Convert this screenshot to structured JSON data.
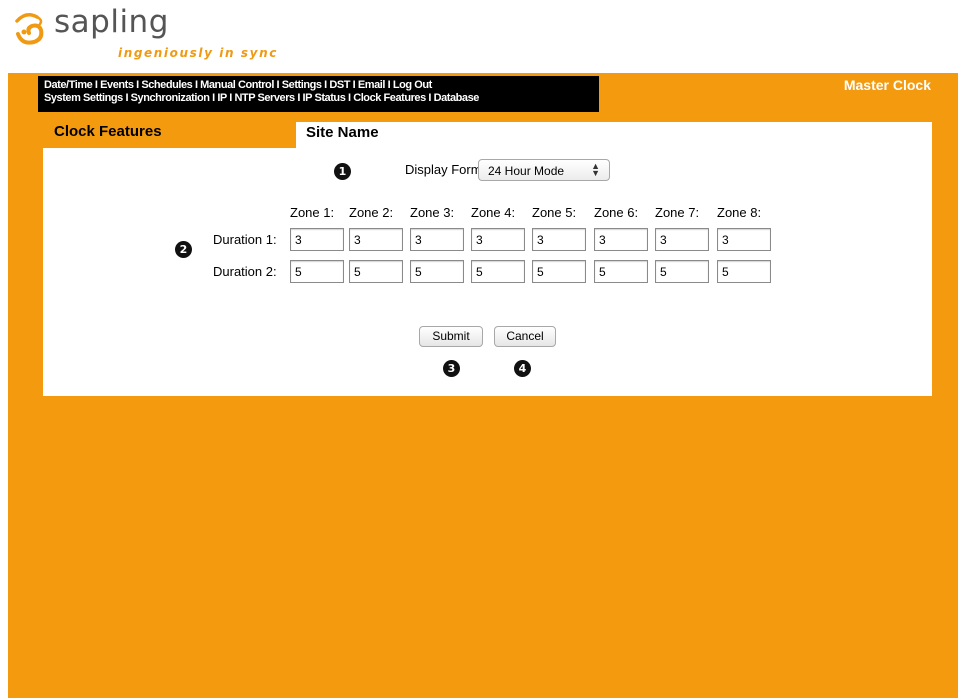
{
  "brand": {
    "name": "sapling",
    "tagline": "ingeniously in sync",
    "accent_color": "#f39a0f",
    "logo_icon": "sapling-swirl-logo"
  },
  "nav": {
    "row1": [
      "Date/Time",
      "Events",
      "Schedules",
      "Manual Control",
      "Settings",
      "DST",
      "Email",
      "Log Out"
    ],
    "row2": [
      "System Settings",
      "Synchronization",
      "IP",
      "NTP Servers",
      "IP Status",
      "Clock Features",
      "Database"
    ],
    "separator": "I"
  },
  "header": {
    "product": "Master Clock",
    "section_title": "Clock Features",
    "site_name": "Site Name"
  },
  "form": {
    "display_format_label": "Display Format:",
    "display_format_value": "24 Hour Mode",
    "zones": [
      "Zone 1:",
      "Zone 2:",
      "Zone 3:",
      "Zone 4:",
      "Zone 5:",
      "Zone 6:",
      "Zone 7:",
      "Zone 8:"
    ],
    "duration1_label": "Duration 1:",
    "duration2_label": "Duration 2:",
    "duration1": [
      "3",
      "3",
      "3",
      "3",
      "3",
      "3",
      "3",
      "3"
    ],
    "duration2": [
      "5",
      "5",
      "5",
      "5",
      "5",
      "5",
      "5",
      "5"
    ],
    "submit_label": "Submit",
    "cancel_label": "Cancel"
  },
  "callouts": [
    "1",
    "2",
    "3",
    "4"
  ]
}
